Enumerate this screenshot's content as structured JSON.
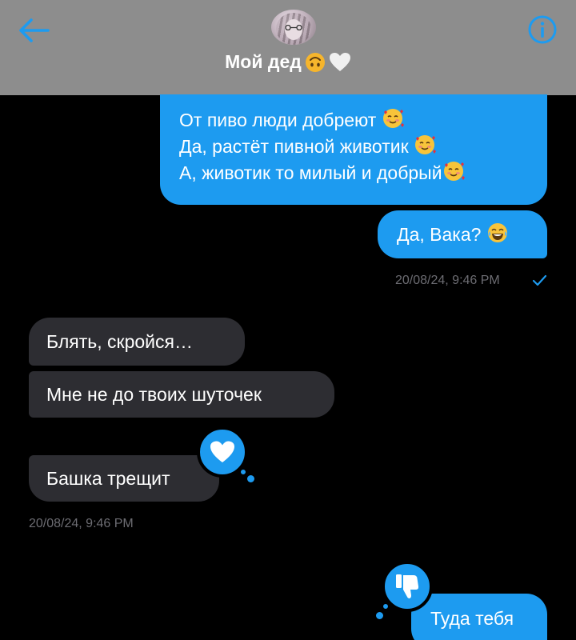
{
  "header": {
    "contact_name": "Мой дед",
    "back_icon": "arrow-left-icon",
    "info_icon": "info-circle-icon",
    "avatar": "contact-avatar",
    "accent": "#1d9bf0"
  },
  "messages": [
    {
      "direction": "outgoing",
      "lines": [
        "От пиво люди добреют",
        "Да, растёт пивной животик",
        "А, животик то милый и добрый"
      ],
      "emoji": "smiling-face-with-hearts"
    },
    {
      "direction": "outgoing",
      "text": "Да, Вака?",
      "emoji": "face-with-tears-of-joy",
      "timestamp": "20/08/24, 9:46 PM",
      "status": "sent-check"
    },
    {
      "direction": "incoming",
      "text": "Блять, скройся…"
    },
    {
      "direction": "incoming",
      "text": "Мне не до твоих шуточек"
    },
    {
      "direction": "incoming",
      "text": "Башка трещит",
      "reaction": "heart",
      "timestamp": "20/08/24, 9:46 PM"
    },
    {
      "direction": "outgoing",
      "text": "Туда тебя",
      "reaction": "thumbs-down"
    }
  ],
  "colors": {
    "outgoing_bubble": "#1d9bf0",
    "incoming_bubble": "#2d2d32",
    "header_bg": "#8d8d8d",
    "timestamp": "#6c6c72"
  }
}
